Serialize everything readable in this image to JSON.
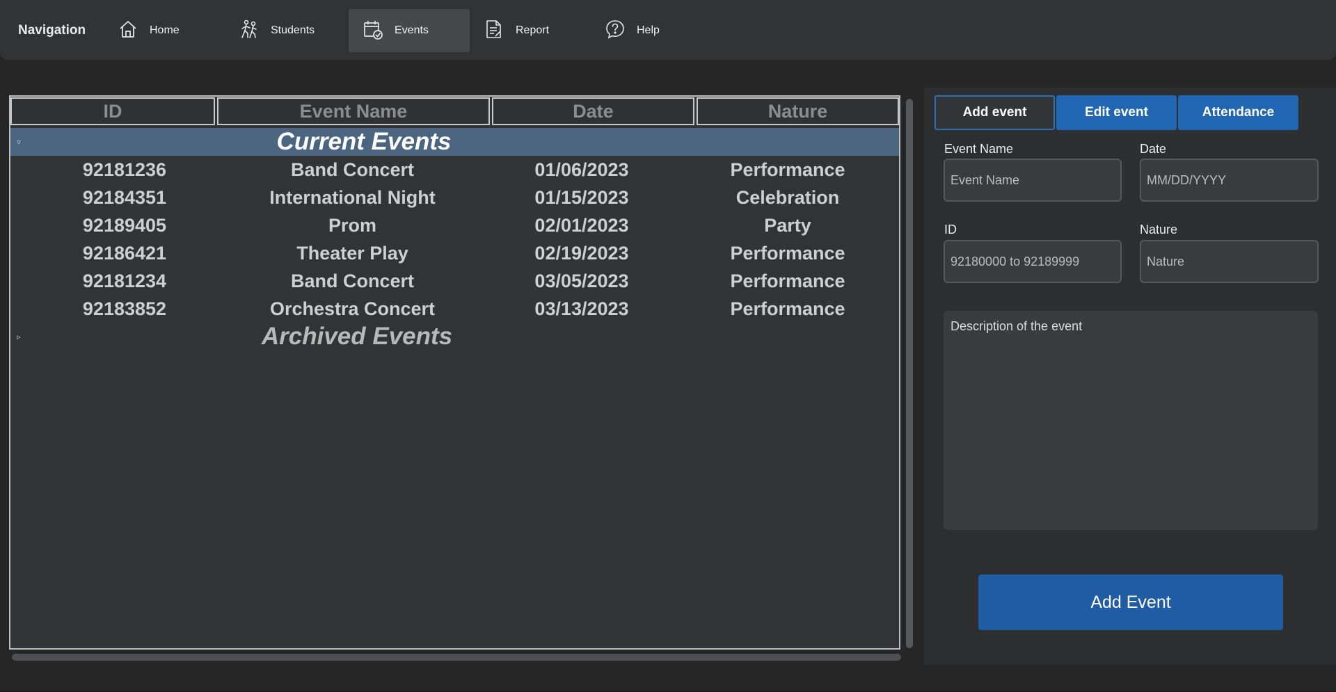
{
  "nav": {
    "title": "Navigation",
    "items": [
      {
        "label": "Home",
        "icon": "home-icon"
      },
      {
        "label": "Students",
        "icon": "students-icon"
      },
      {
        "label": "Events",
        "icon": "calendar-check-icon",
        "active": true
      },
      {
        "label": "Report",
        "icon": "report-icon"
      },
      {
        "label": "Help",
        "icon": "help-icon"
      }
    ]
  },
  "table": {
    "columns": [
      "ID",
      "Event Name",
      "Date",
      "Nature"
    ],
    "groups": {
      "current": "Current Events",
      "archived": "Archived Events"
    },
    "rows": [
      [
        "92181236",
        "Band Concert",
        "01/06/2023",
        "Performance"
      ],
      [
        "92184351",
        "International Night",
        "01/15/2023",
        "Celebration"
      ],
      [
        "92189405",
        "Prom",
        "02/01/2023",
        "Party"
      ],
      [
        "92186421",
        "Theater Play",
        "02/19/2023",
        "Performance"
      ],
      [
        "92181234",
        "Band Concert",
        "03/05/2023",
        "Performance"
      ],
      [
        "92183852",
        "Orchestra Concert",
        "03/13/2023",
        "Performance"
      ]
    ]
  },
  "tabs": [
    "Add event",
    "Edit event",
    "Attendance"
  ],
  "form": {
    "event_name": {
      "label": "Event Name",
      "placeholder": "Event Name"
    },
    "date": {
      "label": "Date",
      "placeholder": "MM/DD/YYYY"
    },
    "id": {
      "label": "ID",
      "placeholder": "92180000 to 92189999"
    },
    "nature": {
      "label": "Nature",
      "placeholder": "Nature"
    },
    "description": {
      "placeholder": "Description of the event"
    },
    "submit_label": "Add Event"
  },
  "colors": {
    "background": "#262626",
    "accent": "#2166b3",
    "group_header": "#4b6480"
  }
}
